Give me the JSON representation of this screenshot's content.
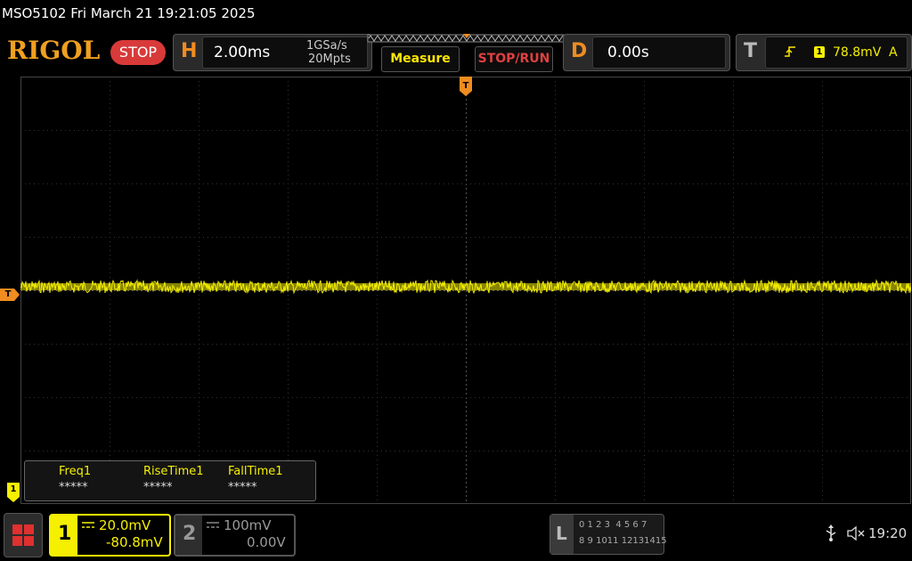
{
  "title_bar": {
    "text": "MSO5102  Fri March 21 19:21:05 2025"
  },
  "brand": {
    "logo": "RIGOL",
    "run_state": "STOP"
  },
  "horizontal": {
    "letter": "H",
    "timebase": "2.00ms",
    "sample_rate": "1GSa/s",
    "memory_depth": "20Mpts"
  },
  "buttons": {
    "measure": "Measure",
    "stop_run": "STOP/RUN"
  },
  "delay": {
    "letter": "D",
    "value": "0.00s"
  },
  "trigger": {
    "letter": "T",
    "channel": "1",
    "level": "78.8mV",
    "mode": "A"
  },
  "markers": {
    "trigger_top": "T",
    "trigger_left": "T",
    "channel1": "1"
  },
  "measurements": [
    {
      "label": "Freq1",
      "value": "*****"
    },
    {
      "label": "RiseTime1",
      "value": "*****"
    },
    {
      "label": "FallTime1",
      "value": "*****"
    }
  ],
  "channel1": {
    "number": "1",
    "scale": "20.0mV",
    "offset": "-80.8mV"
  },
  "channel2": {
    "number": "2",
    "scale": "100mV",
    "offset": "0.00V"
  },
  "logic": {
    "letter": "L",
    "row1": "0 1 2 3  4 5 6 7",
    "row2": "8 9 1011 12131415"
  },
  "status": {
    "time": "19:20"
  },
  "colors": {
    "ch1": "#f5f000",
    "trigger": "#f08c20",
    "stop": "#d83a3a",
    "logo": "#f0a020"
  },
  "icons": {
    "menu": "menu-grid-icon",
    "usb": "usb-icon",
    "sound": "speaker-muted-icon",
    "coupling": "dc-coupling-icon",
    "trigger_edge": "rising-edge-icon"
  }
}
